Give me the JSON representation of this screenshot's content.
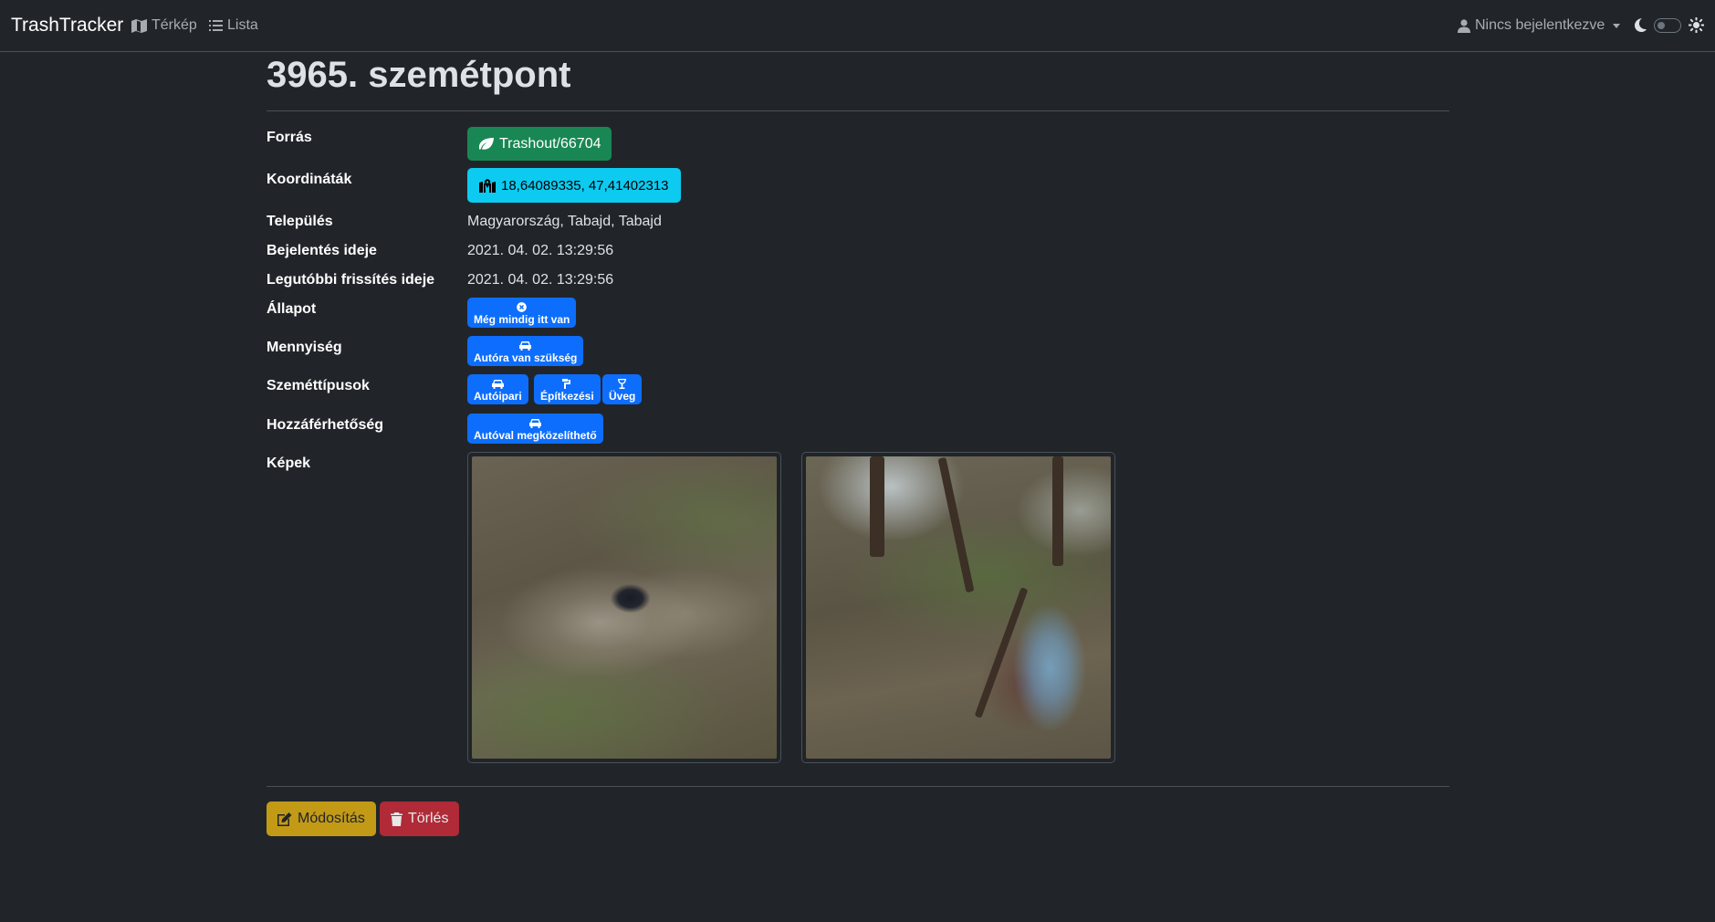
{
  "navbar": {
    "brand": "TrashTracker",
    "map_link": "Térkép",
    "list_link": "Lista",
    "user_menu": "Nincs bejelentkezve"
  },
  "page": {
    "title": "3965. szemétpont"
  },
  "details": {
    "source": {
      "label": "Forrás",
      "value": "Trashout/66704"
    },
    "coordinates": {
      "label": "Koordináták",
      "value": "18,64089335, 47,41402313"
    },
    "settlement": {
      "label": "Település",
      "value": "Magyarország, Tabajd, Tabajd"
    },
    "reported_at": {
      "label": "Bejelentés ideje",
      "value": "2021. 04. 02. 13:29:56"
    },
    "updated_at": {
      "label": "Legutóbbi frissítés ideje",
      "value": "2021. 04. 02. 13:29:56"
    },
    "status": {
      "label": "Állapot",
      "value": "Még mindig itt van"
    },
    "quantity": {
      "label": "Mennyiség",
      "value": "Autóra van szükség"
    },
    "trash_types": {
      "label": "Szeméttípusok",
      "items": [
        "Autóipari",
        "Építkezési",
        "Üveg"
      ]
    },
    "accessibility": {
      "label": "Hozzáférhetőség",
      "value": "Autóval megközelíthető"
    },
    "images": {
      "label": "Képek"
    }
  },
  "actions": {
    "edit": "Módosítás",
    "delete": "Törlés"
  },
  "colors": {
    "background": "#212529",
    "source_button": "#198754",
    "coordinates_button": "#0dcaf0",
    "badge": "#0d6efd",
    "edit_button": "#c39a16",
    "delete_button": "#b02a37"
  }
}
